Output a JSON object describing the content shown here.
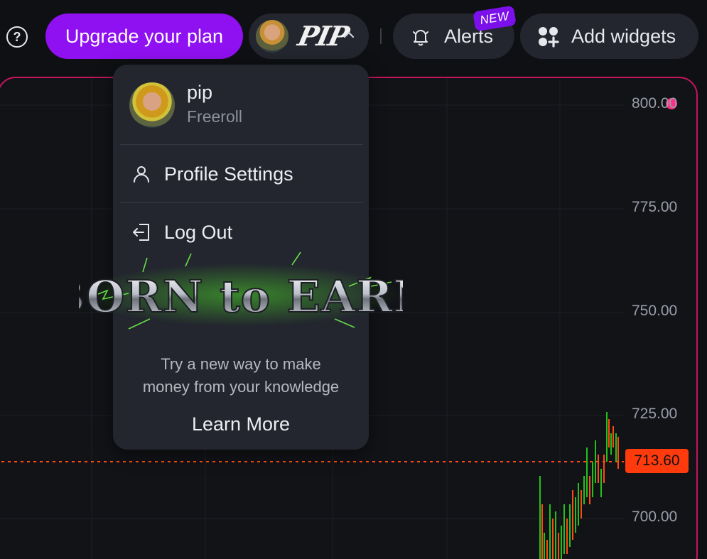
{
  "header": {
    "help_icon": "question-circle-icon",
    "upgrade_label": "Upgrade your plan",
    "user_menu": {
      "logo_text": "PIP",
      "chevron": "chevron-up-icon"
    },
    "alerts": {
      "label": "Alerts",
      "badge": "NEW",
      "icon": "bell-icon"
    },
    "widgets": {
      "label": "Add widgets",
      "icon": "add-widgets-icon"
    }
  },
  "dropdown": {
    "user_name": "pip",
    "user_tier": "Freeroll",
    "items": [
      {
        "label": "Profile Settings",
        "icon": "user-icon"
      },
      {
        "label": "Log Out",
        "icon": "logout-icon"
      }
    ],
    "promo": {
      "title": "BORN to EARN",
      "text_line1": "Try a new way to make",
      "text_line2": "money from your knowledge",
      "cta": "Learn More"
    }
  },
  "chart": {
    "y_labels": [
      "800.00",
      "775.00",
      "750.00",
      "725.00",
      "700.00"
    ],
    "current_price": "713.60",
    "colors": {
      "up": "#22c21a",
      "down": "#ff4a12",
      "accent": "#c5155f",
      "live": "#ff2d84"
    }
  }
}
